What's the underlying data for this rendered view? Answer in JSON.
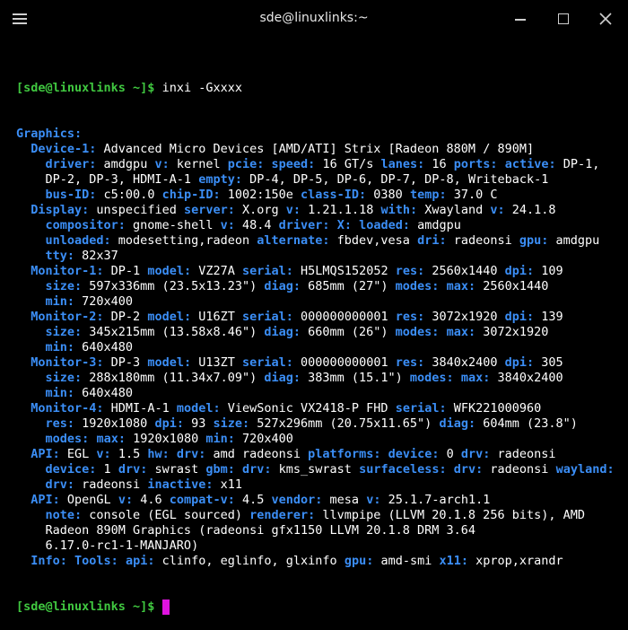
{
  "window": {
    "title": "sde@linuxlinks:~"
  },
  "icons": {
    "menu": "hamburger-menu-icon",
    "minimize": "minimize-icon",
    "maximize": "maximize-icon",
    "close": "close-icon"
  },
  "colors": {
    "background": "#000000",
    "key": "#3b8ef6",
    "prompt": "#40c840",
    "text": "#ffffff",
    "cursor": "#e013e0"
  },
  "prompt": "[sde@linuxlinks ~]$",
  "command": " inxi -Gxxxx",
  "output": [
    [
      {
        "k": "Graphics:"
      }
    ],
    [
      {
        "t": "  "
      },
      {
        "k": "Device-1:"
      },
      {
        "t": " Advanced Micro Devices [AMD/ATI] Strix [Radeon 880M / 890M]"
      }
    ],
    [
      {
        "t": "    "
      },
      {
        "k": "driver:"
      },
      {
        "t": " amdgpu "
      },
      {
        "k": "v:"
      },
      {
        "t": " kernel "
      },
      {
        "k": "pcie:"
      },
      {
        "t": " "
      },
      {
        "k": "speed:"
      },
      {
        "t": " 16 GT/s "
      },
      {
        "k": "lanes:"
      },
      {
        "t": " 16 "
      },
      {
        "k": "ports:"
      },
      {
        "t": " "
      },
      {
        "k": "active:"
      },
      {
        "t": " DP-1,"
      }
    ],
    [
      {
        "t": "    DP-2, DP-3, HDMI-A-1 "
      },
      {
        "k": "empty:"
      },
      {
        "t": " DP-4, DP-5, DP-6, DP-7, DP-8, Writeback-1"
      }
    ],
    [
      {
        "t": "    "
      },
      {
        "k": "bus-ID:"
      },
      {
        "t": " c5:00.0 "
      },
      {
        "k": "chip-ID:"
      },
      {
        "t": " 1002:150e "
      },
      {
        "k": "class-ID:"
      },
      {
        "t": " 0380 "
      },
      {
        "k": "temp:"
      },
      {
        "t": " 37.0 C"
      }
    ],
    [
      {
        "t": "  "
      },
      {
        "k": "Display:"
      },
      {
        "t": " unspecified "
      },
      {
        "k": "server:"
      },
      {
        "t": " X.org "
      },
      {
        "k": "v:"
      },
      {
        "t": " 1.21.1.18 "
      },
      {
        "k": "with:"
      },
      {
        "t": " Xwayland "
      },
      {
        "k": "v:"
      },
      {
        "t": " 24.1.8"
      }
    ],
    [
      {
        "t": "    "
      },
      {
        "k": "compositor:"
      },
      {
        "t": " gnome-shell "
      },
      {
        "k": "v:"
      },
      {
        "t": " 48.4 "
      },
      {
        "k": "driver:"
      },
      {
        "t": " "
      },
      {
        "k": "X:"
      },
      {
        "t": " "
      },
      {
        "k": "loaded:"
      },
      {
        "t": " amdgpu"
      }
    ],
    [
      {
        "t": "    "
      },
      {
        "k": "unloaded:"
      },
      {
        "t": " modesetting,radeon "
      },
      {
        "k": "alternate:"
      },
      {
        "t": " fbdev,vesa "
      },
      {
        "k": "dri:"
      },
      {
        "t": " radeonsi "
      },
      {
        "k": "gpu:"
      },
      {
        "t": " amdgpu"
      }
    ],
    [
      {
        "t": "    "
      },
      {
        "k": "tty:"
      },
      {
        "t": " 82x37"
      }
    ],
    [
      {
        "t": "  "
      },
      {
        "k": "Monitor-1:"
      },
      {
        "t": " DP-1 "
      },
      {
        "k": "model:"
      },
      {
        "t": " VZ27A "
      },
      {
        "k": "serial:"
      },
      {
        "t": " H5LMQS152052 "
      },
      {
        "k": "res:"
      },
      {
        "t": " 2560x1440 "
      },
      {
        "k": "dpi:"
      },
      {
        "t": " 109"
      }
    ],
    [
      {
        "t": "    "
      },
      {
        "k": "size:"
      },
      {
        "t": " 597x336mm (23.5x13.23\") "
      },
      {
        "k": "diag:"
      },
      {
        "t": " 685mm (27\") "
      },
      {
        "k": "modes:"
      },
      {
        "t": " "
      },
      {
        "k": "max:"
      },
      {
        "t": " 2560x1440"
      }
    ],
    [
      {
        "t": "    "
      },
      {
        "k": "min:"
      },
      {
        "t": " 720x400"
      }
    ],
    [
      {
        "t": "  "
      },
      {
        "k": "Monitor-2:"
      },
      {
        "t": " DP-2 "
      },
      {
        "k": "model:"
      },
      {
        "t": " U16ZT "
      },
      {
        "k": "serial:"
      },
      {
        "t": " 000000000001 "
      },
      {
        "k": "res:"
      },
      {
        "t": " 3072x1920 "
      },
      {
        "k": "dpi:"
      },
      {
        "t": " 139"
      }
    ],
    [
      {
        "t": "    "
      },
      {
        "k": "size:"
      },
      {
        "t": " 345x215mm (13.58x8.46\") "
      },
      {
        "k": "diag:"
      },
      {
        "t": " 660mm (26\") "
      },
      {
        "k": "modes:"
      },
      {
        "t": " "
      },
      {
        "k": "max:"
      },
      {
        "t": " 3072x1920"
      }
    ],
    [
      {
        "t": "    "
      },
      {
        "k": "min:"
      },
      {
        "t": " 640x480"
      }
    ],
    [
      {
        "t": "  "
      },
      {
        "k": "Monitor-3:"
      },
      {
        "t": " DP-3 "
      },
      {
        "k": "model:"
      },
      {
        "t": " U13ZT "
      },
      {
        "k": "serial:"
      },
      {
        "t": " 000000000001 "
      },
      {
        "k": "res:"
      },
      {
        "t": " 3840x2400 "
      },
      {
        "k": "dpi:"
      },
      {
        "t": " 305"
      }
    ],
    [
      {
        "t": "    "
      },
      {
        "k": "size:"
      },
      {
        "t": " 288x180mm (11.34x7.09\") "
      },
      {
        "k": "diag:"
      },
      {
        "t": " 383mm (15.1\") "
      },
      {
        "k": "modes:"
      },
      {
        "t": " "
      },
      {
        "k": "max:"
      },
      {
        "t": " 3840x2400"
      }
    ],
    [
      {
        "t": "    "
      },
      {
        "k": "min:"
      },
      {
        "t": " 640x480"
      }
    ],
    [
      {
        "t": "  "
      },
      {
        "k": "Monitor-4:"
      },
      {
        "t": " HDMI-A-1 "
      },
      {
        "k": "model:"
      },
      {
        "t": " ViewSonic VX2418-P FHD "
      },
      {
        "k": "serial:"
      },
      {
        "t": " WFK221000960"
      }
    ],
    [
      {
        "t": "    "
      },
      {
        "k": "res:"
      },
      {
        "t": " 1920x1080 "
      },
      {
        "k": "dpi:"
      },
      {
        "t": " 93 "
      },
      {
        "k": "size:"
      },
      {
        "t": " 527x296mm (20.75x11.65\") "
      },
      {
        "k": "diag:"
      },
      {
        "t": " 604mm (23.8\")"
      }
    ],
    [
      {
        "t": "    "
      },
      {
        "k": "modes:"
      },
      {
        "t": " "
      },
      {
        "k": "max:"
      },
      {
        "t": " 1920x1080 "
      },
      {
        "k": "min:"
      },
      {
        "t": " 720x400"
      }
    ],
    [
      {
        "t": "  "
      },
      {
        "k": "API:"
      },
      {
        "t": " EGL "
      },
      {
        "k": "v:"
      },
      {
        "t": " 1.5 "
      },
      {
        "k": "hw:"
      },
      {
        "t": " "
      },
      {
        "k": "drv:"
      },
      {
        "t": " amd radeonsi "
      },
      {
        "k": "platforms:"
      },
      {
        "t": " "
      },
      {
        "k": "device:"
      },
      {
        "t": " 0 "
      },
      {
        "k": "drv:"
      },
      {
        "t": " radeonsi"
      }
    ],
    [
      {
        "t": "    "
      },
      {
        "k": "device:"
      },
      {
        "t": " 1 "
      },
      {
        "k": "drv:"
      },
      {
        "t": " swrast "
      },
      {
        "k": "gbm:"
      },
      {
        "t": " "
      },
      {
        "k": "drv:"
      },
      {
        "t": " kms_swrast "
      },
      {
        "k": "surfaceless:"
      },
      {
        "t": " "
      },
      {
        "k": "drv:"
      },
      {
        "t": " radeonsi "
      },
      {
        "k": "wayland:"
      }
    ],
    [
      {
        "t": "    "
      },
      {
        "k": "drv:"
      },
      {
        "t": " radeonsi "
      },
      {
        "k": "inactive:"
      },
      {
        "t": " x11"
      }
    ],
    [
      {
        "t": "  "
      },
      {
        "k": "API:"
      },
      {
        "t": " OpenGL "
      },
      {
        "k": "v:"
      },
      {
        "t": " 4.6 "
      },
      {
        "k": "compat-v:"
      },
      {
        "t": " 4.5 "
      },
      {
        "k": "vendor:"
      },
      {
        "t": " mesa "
      },
      {
        "k": "v:"
      },
      {
        "t": " 25.1.7-arch1.1"
      }
    ],
    [
      {
        "t": "    "
      },
      {
        "k": "note:"
      },
      {
        "t": " console (EGL sourced) "
      },
      {
        "k": "renderer:"
      },
      {
        "t": " llvmpipe (LLVM 20.1.8 256 bits), AMD"
      }
    ],
    [
      {
        "t": "    Radeon 890M Graphics (radeonsi gfx1150 LLVM 20.1.8 DRM 3.64"
      }
    ],
    [
      {
        "t": "    6.17.0-rc1-1-MANJARO)"
      }
    ],
    [
      {
        "t": "  "
      },
      {
        "k": "Info:"
      },
      {
        "t": " "
      },
      {
        "k": "Tools:"
      },
      {
        "t": " "
      },
      {
        "k": "api:"
      },
      {
        "t": " clinfo, eglinfo, glxinfo "
      },
      {
        "k": "gpu:"
      },
      {
        "t": " amd-smi "
      },
      {
        "k": "x11:"
      },
      {
        "t": " xprop,xrandr"
      }
    ]
  ]
}
